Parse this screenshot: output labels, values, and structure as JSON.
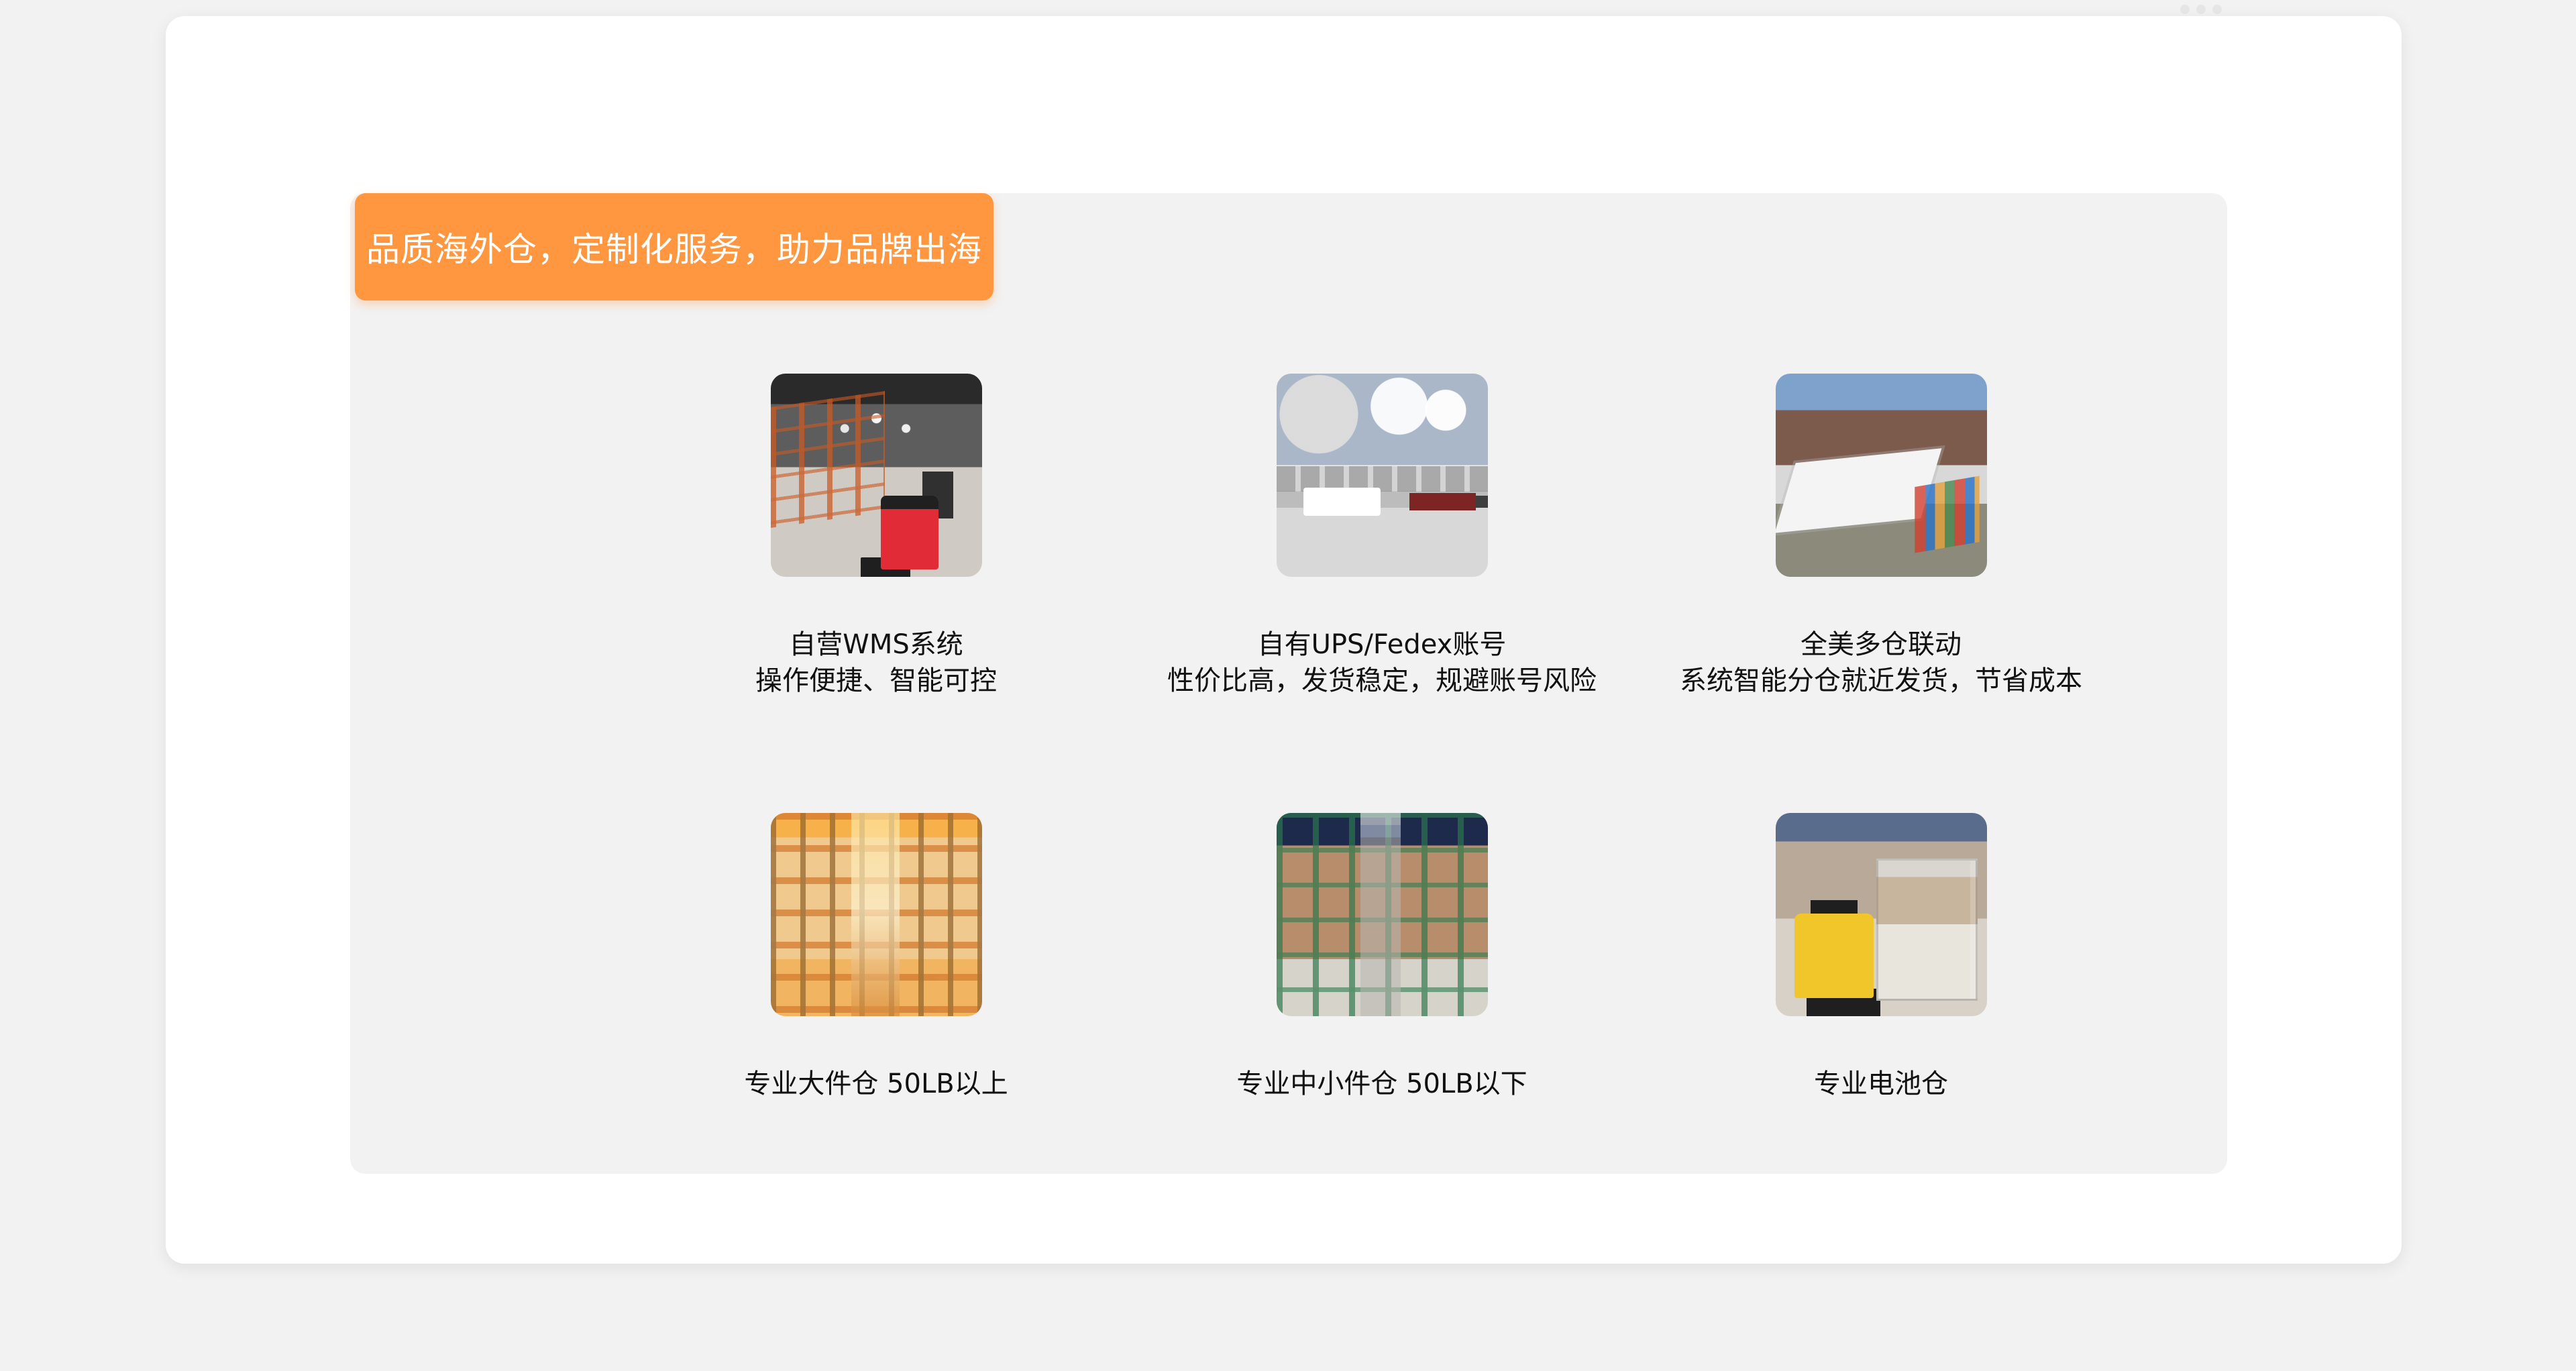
{
  "banner": {
    "text": "品质海外仓，定制化服务，助力品牌出海"
  },
  "features": [
    {
      "title": "自营WMS系统",
      "subtitle": "操作便捷、智能可控"
    },
    {
      "title": "自有UPS/Fedex账号",
      "subtitle": "性价比高，发货稳定，规避账号风险"
    },
    {
      "title": "全美多仓联动",
      "subtitle": "系统智能分仓就近发货，节省成本"
    },
    {
      "title": "专业大件仓  50LB以上",
      "subtitle": ""
    },
    {
      "title": "专业中小件仓  50LB以下",
      "subtitle": ""
    },
    {
      "title": "专业电池仓",
      "subtitle": ""
    }
  ],
  "colors": {
    "page_background": "#f2f2f2",
    "card_background": "#ffffff",
    "panel_background": "#f2f2f2",
    "banner_background": "#ff9741",
    "text_primary": "#111111"
  }
}
